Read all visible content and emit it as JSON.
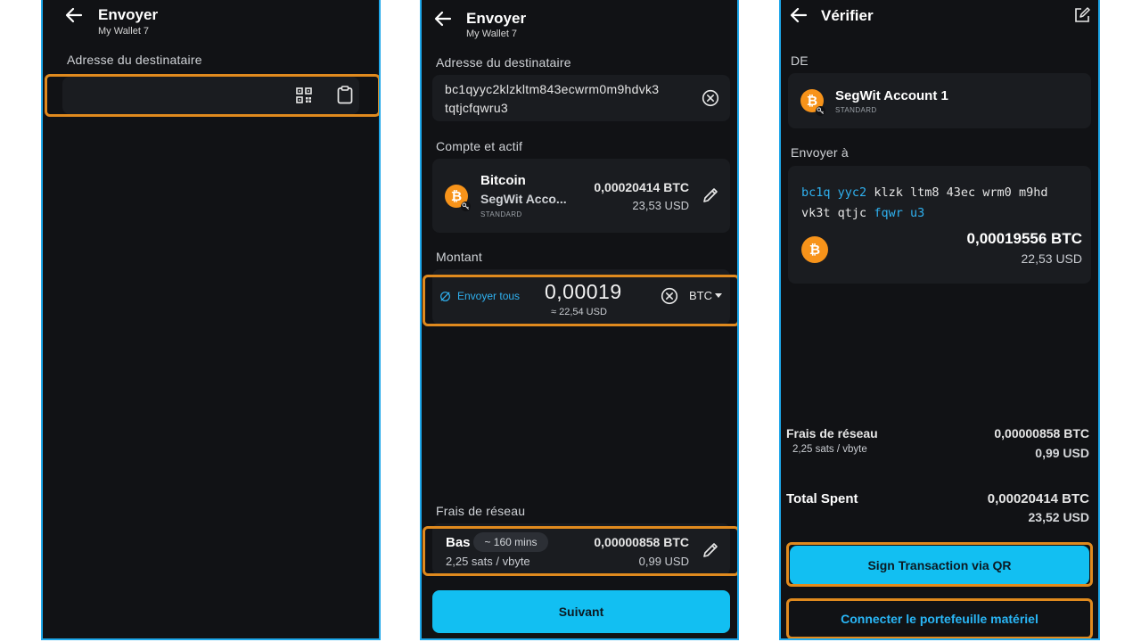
{
  "screen1": {
    "title": "Envoyer",
    "wallet": "My Wallet 7",
    "recipient_label": "Adresse du destinataire",
    "recipient_value": "",
    "icons": [
      "qr-scan-icon",
      "clipboard-icon"
    ]
  },
  "screen2": {
    "title": "Envoyer",
    "wallet": "My Wallet 7",
    "recipient_label": "Adresse du destinataire",
    "address_line1": "bc1qyyc2klzkltm843ecwrm0m9hdvk3",
    "address_line2": "tqtjcfqwru3",
    "account_label": "Compte et actif",
    "asset_name": "Bitcoin",
    "account_name": "SegWit Acco...",
    "account_type": "STANDARD",
    "balance_btc": "0,00020414 BTC",
    "balance_usd": "23,53 USD",
    "amount_label": "Montant",
    "send_all": "Envoyer tous",
    "amount_value": "0,00019",
    "amount_fiat": "≈ 22,54 USD",
    "currency": "BTC",
    "fee_label": "Frais de réseau",
    "fee_speed": "Bas",
    "fee_time": "~ 160 mins",
    "fee_rate": "2,25 sats / vbyte",
    "fee_btc": "0,00000858 BTC",
    "fee_usd": "0,99 USD",
    "next_button": "Suivant"
  },
  "screen3": {
    "title": "Vérifier",
    "from_label": "DE",
    "account_name": "SegWit Account 1",
    "account_type": "STANDARD",
    "send_to_label": "Envoyer à",
    "address_groups_line1": [
      {
        "text": "bc1q",
        "highlight": true
      },
      {
        "text": "yyc2",
        "highlight": true
      },
      {
        "text": "klzk",
        "highlight": false
      },
      {
        "text": "ltm8",
        "highlight": false
      },
      {
        "text": "43ec",
        "highlight": false
      },
      {
        "text": "wrm0",
        "highlight": false
      },
      {
        "text": "m9hd",
        "highlight": false
      }
    ],
    "address_groups_line2": [
      {
        "text": "vk3t",
        "highlight": false
      },
      {
        "text": "qtjc",
        "highlight": false
      },
      {
        "text": "fqwr",
        "highlight": true
      },
      {
        "text": "u3",
        "highlight": true
      }
    ],
    "send_btc": "0,00019556 BTC",
    "send_usd": "22,53 USD",
    "fee_label": "Frais de réseau",
    "fee_rate": "2,25 sats / vbyte",
    "fee_btc": "0,00000858 BTC",
    "fee_usd": "0,99 USD",
    "total_label": "Total Spent",
    "total_btc": "0,00020414 BTC",
    "total_usd": "23,52 USD",
    "sign_button": "Sign Transaction via QR",
    "connect_button": "Connecter le portefeuille matériel"
  },
  "colors": {
    "phone_bg": "#111215",
    "card_bg": "#1a1c20",
    "frame_border": "#1ea7ea",
    "highlight": "#e08a1e",
    "accent": "#12bff2",
    "bitcoin": "#f7931a"
  }
}
